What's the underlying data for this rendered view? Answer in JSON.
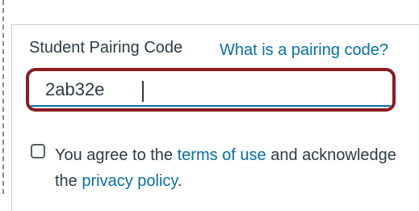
{
  "form": {
    "field_label": "Student Pairing Code",
    "help_link": "What is a pairing code?",
    "code_value": "2ab32e",
    "agree": {
      "prefix": "You agree to the ",
      "terms_link": "terms of use",
      "middle": " and acknowledge the ",
      "privacy_link": "privacy policy",
      "suffix": ".",
      "checked": false
    }
  },
  "colors": {
    "link": "#0770a3",
    "text": "#2d3b45",
    "input_highlight_border": "#8b1c22",
    "focus_underline": "#0770a3"
  },
  "icons": {
    "checkbox": "checkbox-unchecked-icon"
  }
}
